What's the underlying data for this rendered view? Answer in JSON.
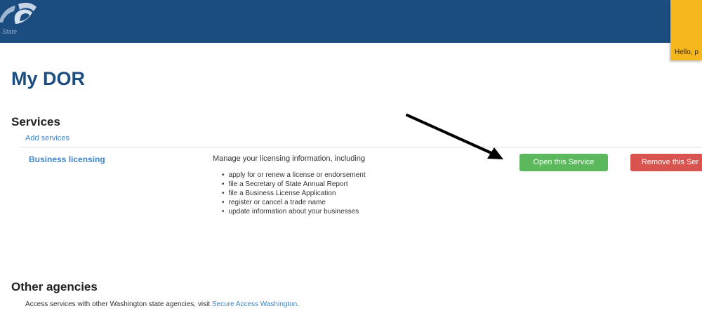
{
  "header": {
    "logo_subtext": "State",
    "colors": {
      "bar": "#1c4d80",
      "user_tab": "#f6b61e"
    }
  },
  "user_menu": {
    "greeting": "Hello, p"
  },
  "page": {
    "title": "My DOR"
  },
  "services": {
    "heading": "Services",
    "add_link": "Add services",
    "items": [
      {
        "name": "Business licensing",
        "description": "Manage your licensing information, including",
        "bullets": [
          "apply for or renew a license or endorsement",
          "file a Secretary of State Annual Report",
          "file a Business License Application",
          "register or cancel a trade name",
          "update information about your businesses"
        ],
        "open_button": "Open this Service",
        "remove_button": "Remove this Ser"
      }
    ]
  },
  "other_agencies": {
    "heading": "Other agencies",
    "text_before": "Access services with other Washington state agencies, visit ",
    "link": "Secure Access Washington",
    "text_after": "."
  },
  "annotation": {
    "arrow_icon": "arrow-pointer-icon",
    "color": "#000000"
  }
}
